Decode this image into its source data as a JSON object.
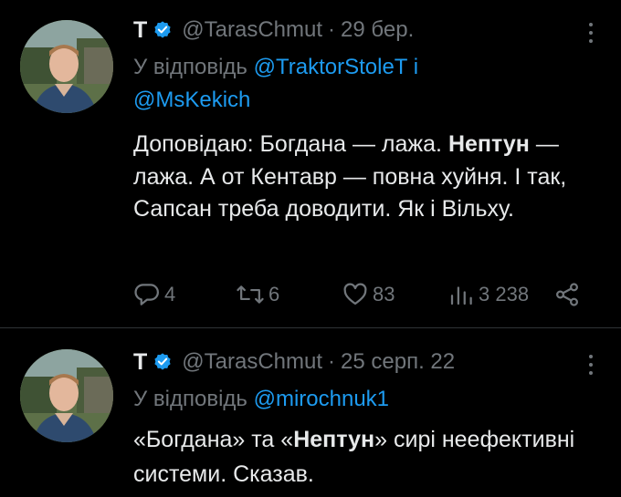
{
  "tweets": [
    {
      "name": "T",
      "handle": "@TarasChmut",
      "separator": "·",
      "date": "29 бер.",
      "reply_prefix": "У відповідь",
      "mention1": "@TraktorStoleT",
      "reply_joiner": "і",
      "mention2": "@MsKekich",
      "text_parts": [
        "Доповідаю: Богдана — лажа. ",
        "Нептун",
        " — лажа. А от Кентавр — повна хуйня. І так, Сапсан треба доводити. Як і Вільху."
      ],
      "actions": {
        "replies": "4",
        "retweets": "6",
        "likes": "83",
        "views": "3 238"
      }
    },
    {
      "name": "T",
      "handle": "@TarasChmut",
      "separator": "·",
      "date": "25 серп. 22",
      "reply_prefix": "У відповідь",
      "mention1": "@mirochnuk1",
      "text_parts": [
        "«Богдана» та «",
        "Нептун",
        "» сирі неефективні системи. Сказав."
      ]
    }
  ],
  "colors": {
    "background": "#000000",
    "text": "#e7e9ea",
    "muted": "#71767b",
    "accent": "#1d9bf0",
    "divider": "#2f3336"
  },
  "icons": [
    "verified-badge-icon",
    "more-options-icon",
    "reply-icon",
    "retweet-icon",
    "like-icon",
    "views-icon",
    "share-icon"
  ]
}
